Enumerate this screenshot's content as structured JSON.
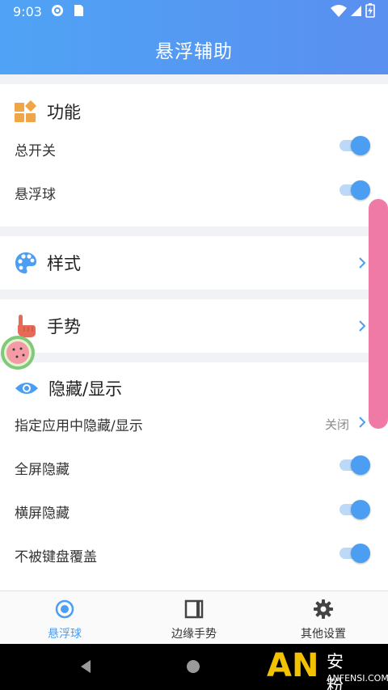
{
  "status_bar": {
    "time": "9:03"
  },
  "app_bar": {
    "title": "悬浮辅助"
  },
  "sections": {
    "function": {
      "title": "功能",
      "rows": [
        {
          "label": "总开关",
          "enabled": true
        },
        {
          "label": "悬浮球",
          "enabled": true
        }
      ]
    },
    "style": {
      "title": "样式"
    },
    "gesture": {
      "title": "手势"
    },
    "hide_show": {
      "title": "隐藏/显示",
      "app_row": {
        "label": "指定应用中隐藏/显示",
        "value": "关闭"
      },
      "rows": [
        {
          "label": "全屏隐藏",
          "enabled": true
        },
        {
          "label": "横屏隐藏",
          "enabled": true
        },
        {
          "label": "不被键盘覆盖",
          "enabled": true
        }
      ]
    }
  },
  "bottom_nav": {
    "items": [
      {
        "label": "悬浮球",
        "active": true
      },
      {
        "label": "边缘手势",
        "active": false
      },
      {
        "label": "其他设置",
        "active": false
      }
    ]
  },
  "watermark": {
    "logo": "AN",
    "name": "安粉丝",
    "domain": "ANFENSI.COM"
  },
  "colors": {
    "accent": "#4b9ef2",
    "appbar_start": "#4fa3f5",
    "appbar_end": "#5a8ff0",
    "scroll_handle": "#ef7aa6"
  }
}
